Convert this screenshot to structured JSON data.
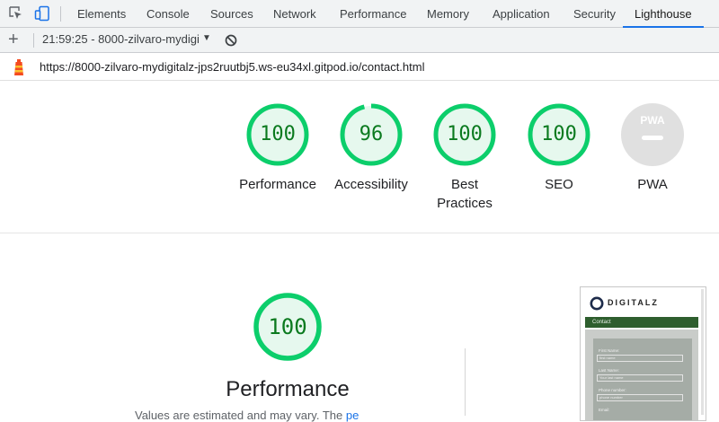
{
  "devtools": {
    "tabs": [
      {
        "label": "Elements"
      },
      {
        "label": "Console"
      },
      {
        "label": "Sources"
      },
      {
        "label": "Network"
      },
      {
        "label": "Performance"
      },
      {
        "label": "Memory"
      },
      {
        "label": "Application"
      },
      {
        "label": "Security"
      },
      {
        "label": "Lighthouse",
        "active": true
      }
    ]
  },
  "toolbar": {
    "report_label": "21:59:25 - 8000-zilvaro-mydigi",
    "caret": "▼",
    "add": "+"
  },
  "url": "https://8000-zilvaro-mydigitalz-jps2ruutbj5.ws-eu34xl.gitpod.io/contact.html",
  "colors": {
    "pass": "#0cce6b",
    "pass_text": "#0b7a1f",
    "pass_fill": "#e6f8ee",
    "pwa_gray": "#e0e0e0",
    "tab_underline": "#1a73e8"
  },
  "scores": [
    {
      "label": "Performance",
      "value": "100",
      "score": 1.0
    },
    {
      "label": "Accessibility",
      "value": "96",
      "score": 0.96
    },
    {
      "label": "Best",
      "label2": "Practices",
      "value": "100",
      "score": 1.0
    },
    {
      "label": "SEO",
      "value": "100",
      "score": 1.0
    },
    {
      "label": "PWA",
      "badge": "PWA"
    }
  ],
  "performance": {
    "value": "100",
    "title": "Performance",
    "description": "Values are estimated and may vary. The",
    "description_link": "pe"
  },
  "screenshot": {
    "brand": "DIGITALZ",
    "nav_item": "Contact",
    "fields": [
      {
        "label": "First Name:",
        "placeholder": "first name"
      },
      {
        "label": "Last Name:",
        "placeholder": "Your last name"
      },
      {
        "label": "Phone number:",
        "placeholder": "phone number"
      },
      {
        "label": "Email:",
        "placeholder": ""
      }
    ]
  }
}
